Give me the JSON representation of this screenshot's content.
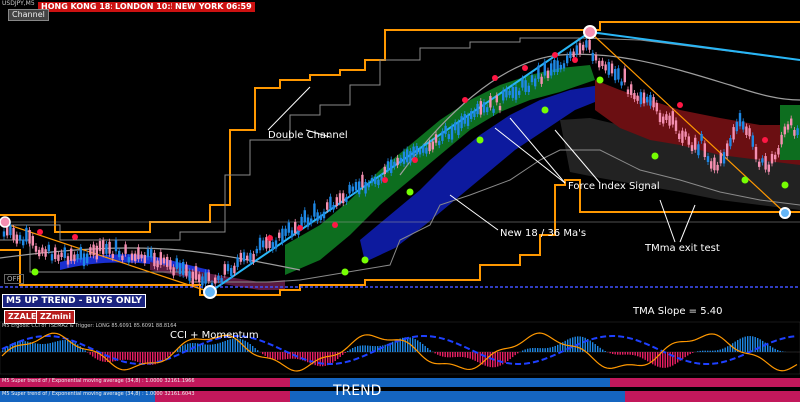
{
  "window": {
    "symbol_line": "USDJPY,M5",
    "channel_button": "Channel"
  },
  "sessions": [
    {
      "label": "HONG KONG 18:59",
      "color": "#cc1111"
    },
    {
      "label": "LONDON 10:59",
      "color": "#cc1111"
    },
    {
      "label": "NEW YORK 06:59",
      "color": "#cc1111"
    }
  ],
  "annotations": {
    "double_channel": "Double Channel",
    "force_index": "Force Index Signal",
    "new_ma": "New 18 / 36 Ma's",
    "tmma_exit": "TMma exit test",
    "tma_slope": "TMA Slope = 5.40",
    "cci_momentum": "CCI + Momentum",
    "trend": "TREND"
  },
  "signals": {
    "trend_banner": "M5 UP TREND - BUYS ONLY",
    "zzalert": "ZZALERT",
    "zzmini": "ZZmini",
    "off_label": "OFF"
  },
  "indicators": {
    "cci_header": "M5 Ergodic CCI of TSEMA2 & Trigger: LONG 85.6091 85.6091 88.8164",
    "trend_row1": "M5 Super trend of / Exponential moving average (34,8) : 1.0000 32161.1966",
    "trend_row2": "M5 Super trend of / Exponential moving average (34,8) : 1.0000 32161.6043"
  },
  "colors": {
    "background": "#000000",
    "up_candle": "#1e88e5",
    "down_candle": "#f48fb1",
    "channel_orange": "#ff9800",
    "channel_grey": "#9e9e9e",
    "buy_band": "#0d6e1f",
    "ma_band": "#0d1a9e",
    "sell_band": "#6b0f12",
    "trend_blue": "#1565c0",
    "trend_magenta": "#c2185b",
    "session_red": "#cc1111"
  }
}
